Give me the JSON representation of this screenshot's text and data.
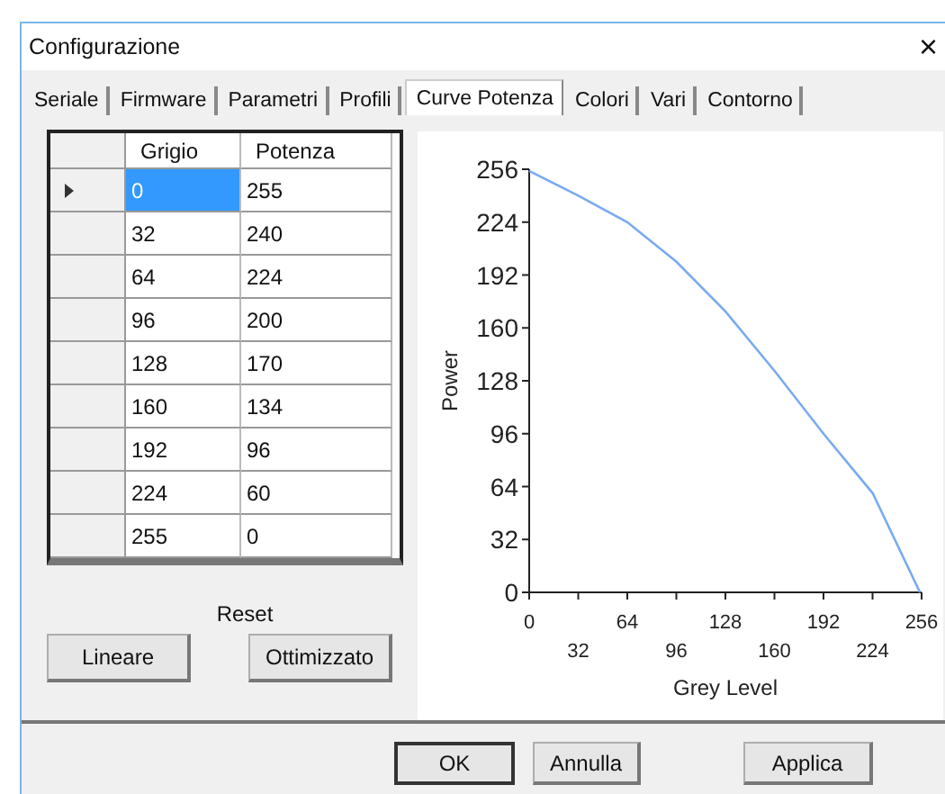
{
  "window": {
    "title": "Configurazione",
    "close": "×"
  },
  "tabs": [
    {
      "label": "Seriale",
      "selected": false
    },
    {
      "label": "Firmware",
      "selected": false
    },
    {
      "label": "Parametri",
      "selected": false
    },
    {
      "label": "Profili",
      "selected": false
    },
    {
      "label": "Curve Potenza",
      "selected": true
    },
    {
      "label": "Colori",
      "selected": false
    },
    {
      "label": "Vari",
      "selected": false
    },
    {
      "label": "Contorno",
      "selected": false
    }
  ],
  "table": {
    "columns": [
      "Grigio",
      "Potenza"
    ],
    "rows": [
      {
        "cells": [
          "0",
          "255"
        ],
        "selected": true
      },
      {
        "cells": [
          "32",
          "240"
        ],
        "selected": false
      },
      {
        "cells": [
          "64",
          "224"
        ],
        "selected": false
      },
      {
        "cells": [
          "96",
          "200"
        ],
        "selected": false
      },
      {
        "cells": [
          "128",
          "170"
        ],
        "selected": false
      },
      {
        "cells": [
          "160",
          "134"
        ],
        "selected": false
      },
      {
        "cells": [
          "192",
          "96"
        ],
        "selected": false
      },
      {
        "cells": [
          "224",
          "60"
        ],
        "selected": false
      },
      {
        "cells": [
          "255",
          "0"
        ],
        "selected": false
      }
    ]
  },
  "reset": {
    "label": "Reset",
    "buttons": [
      "Lineare",
      "Ottimizzato"
    ]
  },
  "chart": {
    "chart_data": {
      "type": "line",
      "xlabel": "Grey Level",
      "ylabel": "Power",
      "x": [
        0,
        32,
        64,
        96,
        128,
        160,
        192,
        224,
        255
      ],
      "series": [
        {
          "color": "#7aaaf0",
          "values": [
            255,
            240,
            224,
            200,
            170,
            134,
            96,
            60,
            0
          ]
        }
      ],
      "xlim": [
        0,
        256
      ],
      "ylim": [
        0,
        256
      ],
      "xticks": [
        0,
        64,
        128,
        192,
        256
      ],
      "annotations": [
        "32",
        "96",
        "160",
        "224"
      ],
      "yticks": [
        0,
        32,
        64,
        96,
        128,
        160,
        192,
        224,
        256
      ]
    }
  },
  "buttons": [
    "OK",
    "Annulla",
    "Applica"
  ]
}
